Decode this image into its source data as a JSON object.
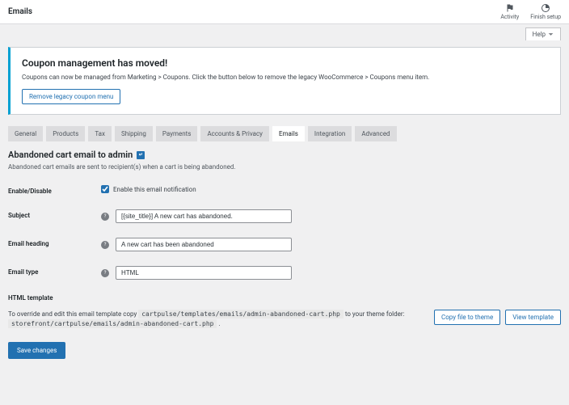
{
  "topbar": {
    "title": "Emails",
    "activity": "Activity",
    "finish": "Finish setup"
  },
  "help_tab": "Help",
  "notice": {
    "title": "Coupon management has moved!",
    "body": "Coupons can now be managed from Marketing > Coupons. Click the button below to remove the legacy WooCommerce > Coupons menu item.",
    "button": "Remove legacy coupon menu"
  },
  "tabs": [
    "General",
    "Products",
    "Tax",
    "Shipping",
    "Payments",
    "Accounts & Privacy",
    "Emails",
    "Integration",
    "Advanced"
  ],
  "active_tab": 6,
  "section": {
    "title": "Abandoned cart email to admin",
    "desc": "Abandoned cart emails are sent to recipient(s) when a cart is being abandoned."
  },
  "fields": {
    "enable": {
      "label": "Enable/Disable",
      "checkbox_label": "Enable this email notification",
      "checked": true
    },
    "subject": {
      "label": "Subject",
      "value": "[{site_title}] A new cart has abandoned."
    },
    "heading": {
      "label": "Email heading",
      "value": "A new cart has been abandoned"
    },
    "type": {
      "label": "Email type",
      "value": "HTML"
    }
  },
  "template": {
    "title": "HTML template",
    "desc_prefix": "To override and edit this email template copy ",
    "path1": "cartpulse/templates/emails/admin-abandoned-cart.php",
    "desc_mid": " to your theme folder: ",
    "path2": "storefront/cartpulse/emails/admin-abandoned-cart.php",
    "desc_suffix": " .",
    "copy_btn": "Copy file to theme",
    "view_btn": "View template"
  },
  "save": "Save changes"
}
